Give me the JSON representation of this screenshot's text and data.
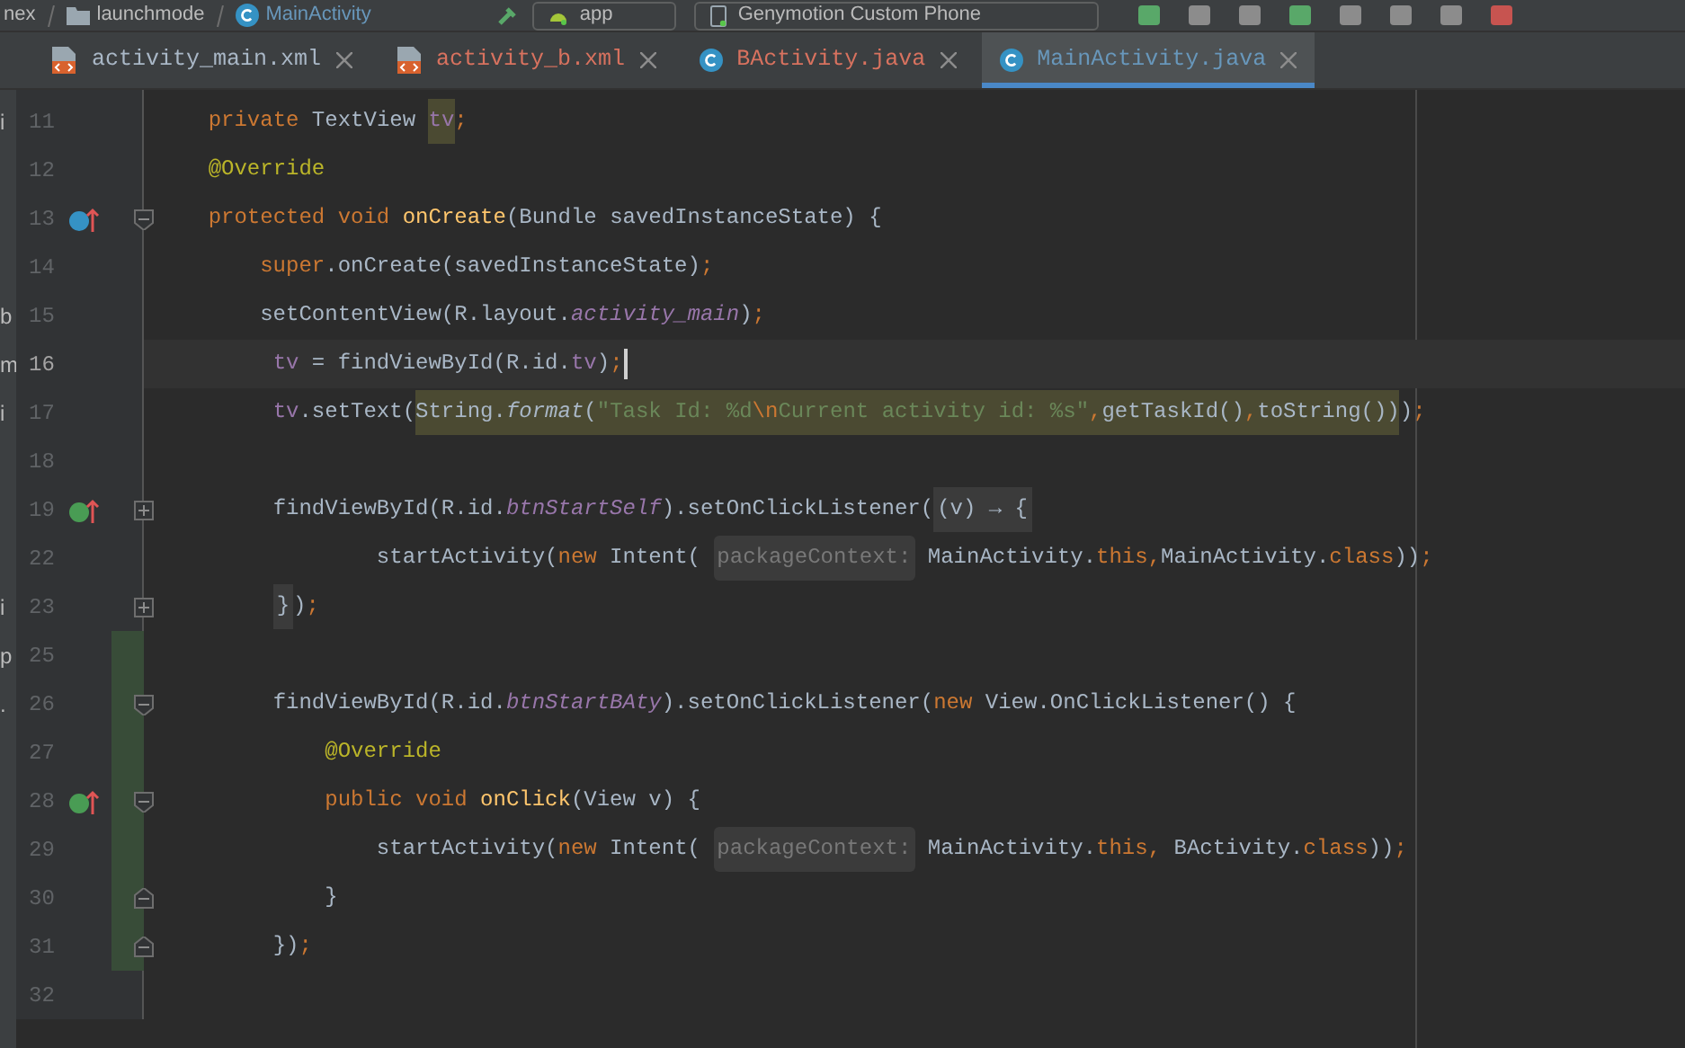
{
  "toolbar": {
    "breadcrumbs": [
      {
        "label": "nex",
        "kind": "text"
      },
      {
        "label": "launchmode",
        "kind": "folder"
      },
      {
        "label": "MainActivity",
        "kind": "class"
      }
    ],
    "run_config": "app",
    "device": "Genymotion Custom Phone"
  },
  "tabs": [
    {
      "label": "activity_main.xml",
      "kind": "xml",
      "color": "#a9b7c6",
      "selected": false
    },
    {
      "label": "activity_b.xml",
      "kind": "xml",
      "color": "#d8725f",
      "selected": false
    },
    {
      "label": "BActivity.java",
      "kind": "class",
      "color": "#d8725f",
      "selected": false
    },
    {
      "label": "MainActivity.java",
      "kind": "class",
      "color": "#6897bb",
      "selected": true
    }
  ],
  "lines": [
    {
      "number": "11",
      "edge": "i",
      "tokens": [
        {
          "t": "    private",
          "kind": "kw"
        },
        {
          "t": " TextView ",
          "kind": "plain"
        },
        {
          "t": "tv",
          "kind": "field",
          "highlight": true
        },
        {
          "t": ";",
          "kind": "punct"
        }
      ]
    },
    {
      "number": "12",
      "tokens": [
        {
          "t": "    @Override",
          "kind": "ann"
        }
      ]
    },
    {
      "number": "13",
      "gutter_icon": {
        "kind": "override"
      },
      "fold_marker": {
        "kind": "start"
      },
      "tokens": [
        {
          "t": "    protected void",
          "kind": "kw"
        },
        {
          "t": " onCreate",
          "kind": "decl"
        },
        {
          "t": "(Bundle savedInstanceState) {",
          "kind": "plain"
        }
      ]
    },
    {
      "number": "14",
      "tokens": [
        {
          "t": "        super",
          "kind": "kw"
        },
        {
          "t": ".onCreate(savedInstanceState)",
          "kind": "plain"
        },
        {
          "t": ";",
          "kind": "punct"
        }
      ]
    },
    {
      "number": "15",
      "edge": "b",
      "tokens": [
        {
          "t": "        setContentView(R.layout.",
          "kind": "plain"
        },
        {
          "t": "activity_main",
          "kind": "field_italic"
        },
        {
          "t": ")",
          "kind": "plain"
        },
        {
          "t": ";",
          "kind": "punct"
        }
      ]
    },
    {
      "number": "16",
      "edge": "m",
      "current": true,
      "caret": true,
      "tokens": [
        {
          "t": "         tv",
          "kind": "field"
        },
        {
          "t": " = findViewById(R.id.",
          "kind": "plain"
        },
        {
          "t": "tv",
          "kind": "field"
        },
        {
          "t": ")",
          "kind": "plain"
        },
        {
          "t": ";",
          "kind": "punct"
        }
      ]
    },
    {
      "number": "17",
      "edge": "i",
      "tokens": [
        {
          "t": "         tv",
          "kind": "field"
        },
        {
          "t": ".setText(",
          "kind": "plain"
        },
        {
          "t": "String.",
          "kind": "plain",
          "highlight": true
        },
        {
          "t": "format",
          "kind": "italic",
          "highlight": true
        },
        {
          "t": "(",
          "kind": "plain",
          "highlight": true
        },
        {
          "t": "\"Task Id: %d",
          "kind": "str",
          "highlight": true
        },
        {
          "t": "\\n",
          "kind": "escape",
          "highlight": true
        },
        {
          "t": "Current activity id: %s\"",
          "kind": "str",
          "highlight": true
        },
        {
          "t": ",",
          "kind": "punct",
          "highlight": true
        },
        {
          "t": "getTaskId()",
          "kind": "plain",
          "highlight": true
        },
        {
          "t": ",",
          "kind": "punct",
          "highlight": true
        },
        {
          "t": "toString())",
          "kind": "plain",
          "highlight": true
        },
        {
          "t": ")",
          "kind": "plain"
        },
        {
          "t": ";",
          "kind": "punct"
        }
      ]
    },
    {
      "number": "18"
    },
    {
      "number": "19",
      "gutter_icon": {
        "kind": "implement"
      },
      "fold_marker": {
        "kind": "collapsed"
      },
      "tokens": [
        {
          "t": "         findViewById(R.id.",
          "kind": "plain"
        },
        {
          "t": "btnStartSelf",
          "kind": "field_italic"
        },
        {
          "t": ").setOnClickListener(",
          "kind": "plain"
        },
        {
          "t": "(v) → {",
          "kind": "folded"
        }
      ]
    },
    {
      "number": "22",
      "tokens": [
        {
          "t": "                 startActivity(",
          "kind": "plain"
        },
        {
          "t": "new",
          "kind": "kw"
        },
        {
          "t": " Intent( ",
          "kind": "plain"
        },
        {
          "t": "packageContext:",
          "kind": "hint"
        },
        {
          "t": " MainActivity.",
          "kind": "plain"
        },
        {
          "t": "this",
          "kind": "kw"
        },
        {
          "t": ",",
          "kind": "punct"
        },
        {
          "t": "MainActivity.",
          "kind": "plain"
        },
        {
          "t": "class",
          "kind": "kw"
        },
        {
          "t": "))",
          "kind": "plain"
        },
        {
          "t": ";",
          "kind": "punct"
        }
      ]
    },
    {
      "number": "23",
      "edge": "i",
      "fold_marker": {
        "kind": "collapsed"
      },
      "tokens": [
        {
          "t": "         }",
          "kind": "folded"
        },
        {
          "t": ")",
          "kind": "plain"
        },
        {
          "t": ";",
          "kind": "punct"
        }
      ]
    },
    {
      "number": "25",
      "edge": "p",
      "changed": true
    },
    {
      "number": "26",
      "edge": ".",
      "changed": true,
      "fold_marker": {
        "kind": "start"
      },
      "tokens": [
        {
          "t": "         findViewById(R.id.",
          "kind": "plain"
        },
        {
          "t": "btnStartBAty",
          "kind": "field_italic"
        },
        {
          "t": ").setOnClickListener(",
          "kind": "plain"
        },
        {
          "t": "new",
          "kind": "kw"
        },
        {
          "t": " View.OnClickListener() {",
          "kind": "plain"
        }
      ]
    },
    {
      "number": "27",
      "changed": true,
      "tokens": [
        {
          "t": "             @Override",
          "kind": "ann"
        }
      ]
    },
    {
      "number": "28",
      "changed": true,
      "gutter_icon": {
        "kind": "implement"
      },
      "fold_marker": {
        "kind": "start"
      },
      "tokens": [
        {
          "t": "             public void",
          "kind": "kw"
        },
        {
          "t": " onClick",
          "kind": "decl"
        },
        {
          "t": "(View v) {",
          "kind": "plain"
        }
      ]
    },
    {
      "number": "29",
      "changed": true,
      "tokens": [
        {
          "t": "                 startActivity(",
          "kind": "plain"
        },
        {
          "t": "new",
          "kind": "kw"
        },
        {
          "t": " Intent( ",
          "kind": "plain"
        },
        {
          "t": "packageContext:",
          "kind": "hint"
        },
        {
          "t": " MainActivity.",
          "kind": "plain"
        },
        {
          "t": "this",
          "kind": "kw"
        },
        {
          "t": ", ",
          "kind": "punct"
        },
        {
          "t": "BActivity.",
          "kind": "plain"
        },
        {
          "t": "class",
          "kind": "kw"
        },
        {
          "t": "))",
          "kind": "plain"
        },
        {
          "t": ";",
          "kind": "punct"
        }
      ]
    },
    {
      "number": "30",
      "changed": true,
      "fold_marker": {
        "kind": "end"
      },
      "tokens": [
        {
          "t": "             }",
          "kind": "plain"
        }
      ]
    },
    {
      "number": "31",
      "changed": true,
      "fold_marker": {
        "kind": "end"
      },
      "tokens": [
        {
          "t": "         })",
          "kind": "plain"
        },
        {
          "t": ";",
          "kind": "punct"
        }
      ]
    },
    {
      "number": "32"
    }
  ]
}
